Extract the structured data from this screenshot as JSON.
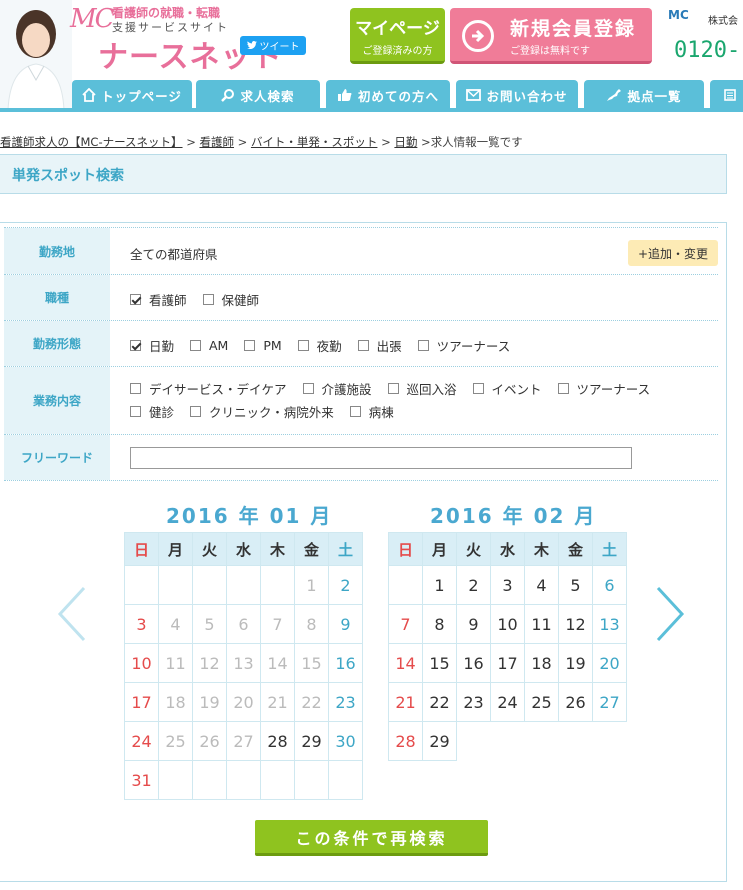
{
  "header": {
    "logo_mc": "MC",
    "tagline_1": "看護師の就職・転職",
    "tagline_2": "支援サービスサイト",
    "brand": "ナースネット",
    "tweet_label": "ツイート",
    "mypage_title": "マイページ",
    "mypage_sub": "ご登録済みの方",
    "register_title": "新規会員登録",
    "register_sub": "ご登録は無料です",
    "corp_name": "株式会",
    "corp_logo": "MC",
    "tel": "0120-"
  },
  "nav": [
    {
      "label": "トップページ",
      "icon": "home-icon"
    },
    {
      "label": "求人検索",
      "icon": "search-icon"
    },
    {
      "label": "初めての方へ",
      "icon": "thumbs-up-icon"
    },
    {
      "label": "お問い合わせ",
      "icon": "mail-icon"
    },
    {
      "label": "拠点一覧",
      "icon": "japan-map-icon"
    }
  ],
  "breadcrumb": {
    "items": [
      "看護師求人の【MC-ナースネット】",
      "看護師",
      "バイト・単発・スポット",
      "日勤"
    ],
    "current": "求人情報一覧です"
  },
  "section_title": "単発スポット検索",
  "form": {
    "location": {
      "label": "勤務地",
      "value": "全ての都道府県",
      "button": "+追加・変更"
    },
    "job_type": {
      "label": "職種",
      "options": [
        {
          "text": "看護師",
          "checked": true
        },
        {
          "text": "保健師",
          "checked": false
        }
      ]
    },
    "work_style": {
      "label": "勤務形態",
      "options": [
        {
          "text": "日勤",
          "checked": true
        },
        {
          "text": "AM",
          "checked": false
        },
        {
          "text": "PM",
          "checked": false
        },
        {
          "text": "夜勤",
          "checked": false
        },
        {
          "text": "出張",
          "checked": false
        },
        {
          "text": "ツアーナース",
          "checked": false
        }
      ]
    },
    "duties": {
      "label": "業務内容",
      "options_row1": [
        {
          "text": "デイサービス・デイケア",
          "checked": false
        },
        {
          "text": "介護施設",
          "checked": false
        },
        {
          "text": "巡回入浴",
          "checked": false
        },
        {
          "text": "イベント",
          "checked": false
        },
        {
          "text": "ツアーナース",
          "checked": false
        }
      ],
      "options_row2": [
        {
          "text": "健診",
          "checked": false
        },
        {
          "text": "クリニック・病院外来",
          "checked": false
        },
        {
          "text": "病棟",
          "checked": false
        }
      ]
    },
    "freeword": {
      "label": "フリーワード",
      "value": "",
      "placeholder": ""
    }
  },
  "calendar": {
    "weekdays": [
      "日",
      "月",
      "火",
      "水",
      "木",
      "金",
      "土"
    ],
    "months": [
      {
        "title": "2016 年 01 月",
        "weeks": [
          [
            "",
            "",
            "",
            "",
            "",
            "1",
            "2"
          ],
          [
            "3",
            "4",
            "5",
            "6",
            "7",
            "8",
            "9"
          ],
          [
            "10",
            "11",
            "12",
            "13",
            "14",
            "15",
            "16"
          ],
          [
            "17",
            "18",
            "19",
            "20",
            "21",
            "22",
            "23"
          ],
          [
            "24",
            "25",
            "26",
            "27",
            "28",
            "29",
            "30"
          ],
          [
            "31",
            "",
            "",
            "",
            "",
            "",
            ""
          ]
        ],
        "active_from": 28
      },
      {
        "title": "2016 年 02 月",
        "weeks": [
          [
            "",
            "1",
            "2",
            "3",
            "4",
            "5",
            "6"
          ],
          [
            "7",
            "8",
            "9",
            "10",
            "11",
            "12",
            "13"
          ],
          [
            "14",
            "15",
            "16",
            "17",
            "18",
            "19",
            "20"
          ],
          [
            "21",
            "22",
            "23",
            "24",
            "25",
            "26",
            "27"
          ],
          [
            "28",
            "29",
            "",
            "",
            "",
            "",
            ""
          ]
        ],
        "active_from": 1
      }
    ]
  },
  "search_button": "この条件で再検索",
  "colors": {
    "accent": "#5bbfd9",
    "green": "#8fc31f",
    "pink": "#f07c98",
    "sunday": "#e54b4b",
    "saturday": "#3da6c6"
  }
}
